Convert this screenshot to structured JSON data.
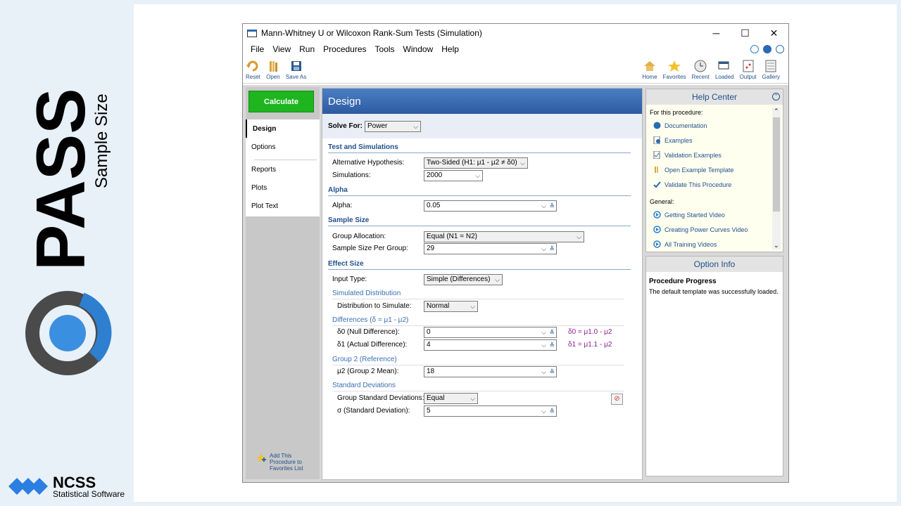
{
  "brand": {
    "product": "PASS",
    "tagline": "Sample Size",
    "company": "NCSS",
    "company_sub": "Statistical Software"
  },
  "window": {
    "title": "Mann-Whitney U or Wilcoxon Rank-Sum Tests (Simulation)",
    "controls": {
      "minimize": "─",
      "maximize": "☐",
      "close": "✕"
    }
  },
  "menu": [
    "File",
    "View",
    "Run",
    "Procedures",
    "Tools",
    "Window",
    "Help"
  ],
  "toolbar": {
    "left": [
      {
        "label": "Reset",
        "icon": "reset-icon"
      },
      {
        "label": "Open",
        "icon": "open-icon"
      },
      {
        "label": "Save As",
        "icon": "save-icon"
      }
    ],
    "right": [
      {
        "label": "Home",
        "icon": "home-icon"
      },
      {
        "label": "Favorites",
        "icon": "star-icon"
      },
      {
        "label": "Recent",
        "icon": "clock-icon"
      },
      {
        "label": "Loaded",
        "icon": "window-icon"
      },
      {
        "label": "Output",
        "icon": "output-icon"
      },
      {
        "label": "Gallery",
        "icon": "gallery-icon"
      }
    ]
  },
  "nav": {
    "calculate": "Calculate",
    "items": [
      "Design",
      "Options",
      "Reports",
      "Plots",
      "Plot Text"
    ],
    "add_fav": [
      "Add This",
      "Procedure to",
      "Favorites List"
    ]
  },
  "design": {
    "header": "Design",
    "solve_for_label": "Solve For:",
    "solve_for_value": "Power",
    "sections": {
      "test": "Test and Simulations",
      "alpha": "Alpha",
      "sample": "Sample Size",
      "effect": "Effect Size"
    },
    "subsections": {
      "sim_dist": "Simulated Distribution",
      "differences": "Differences (δ = μ1 - μ2)",
      "group2": "Group 2 (Reference)",
      "sd": "Standard Deviations"
    },
    "fields": {
      "alt_hyp": {
        "label": "Alternative Hypothesis:",
        "value": "Two-Sided (H1: μ1 - μ2 ≠ δ0)"
      },
      "simulations": {
        "label": "Simulations:",
        "value": "2000"
      },
      "alpha": {
        "label": "Alpha:",
        "value": "0.05"
      },
      "group_alloc": {
        "label": "Group Allocation:",
        "value": "Equal (N1 = N2)"
      },
      "sample_size": {
        "label": "Sample Size Per Group:",
        "value": "29"
      },
      "input_type": {
        "label": "Input Type:",
        "value": "Simple (Differences)"
      },
      "dist": {
        "label": "Distribution to Simulate:",
        "value": "Normal"
      },
      "delta0": {
        "label": "δ0 (Null Difference):",
        "value": "0",
        "note": "δ0 = μ1.0 - μ2"
      },
      "delta1": {
        "label": "δ1 (Actual Difference):",
        "value": "4",
        "note": "δ1 = μ1.1 - μ2"
      },
      "mu2": {
        "label": "μ2 (Group 2 Mean):",
        "value": "18"
      },
      "group_sd": {
        "label": "Group Standard Deviations:",
        "value": "Equal"
      },
      "sigma": {
        "label": "σ (Standard Deviation):",
        "value": "5"
      }
    }
  },
  "help": {
    "header": "Help Center",
    "for_proc": "For this procedure:",
    "proc_items": [
      "Documentation",
      "Examples",
      "Validation Examples",
      "Open Example Template",
      "Validate This Procedure"
    ],
    "general": "General:",
    "general_items": [
      "Getting Started Video",
      "Creating Power Curves Video",
      "All Training Videos"
    ]
  },
  "option_info": {
    "header": "Option Info",
    "title": "Procedure Progress",
    "text": "The default template was successfully loaded."
  }
}
